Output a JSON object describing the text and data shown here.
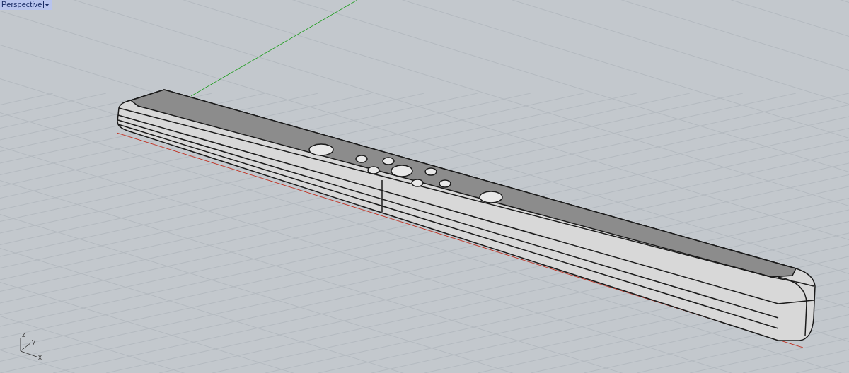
{
  "viewport": {
    "title": "Perspective",
    "axis_labels": [
      "z",
      "y",
      "x"
    ]
  }
}
